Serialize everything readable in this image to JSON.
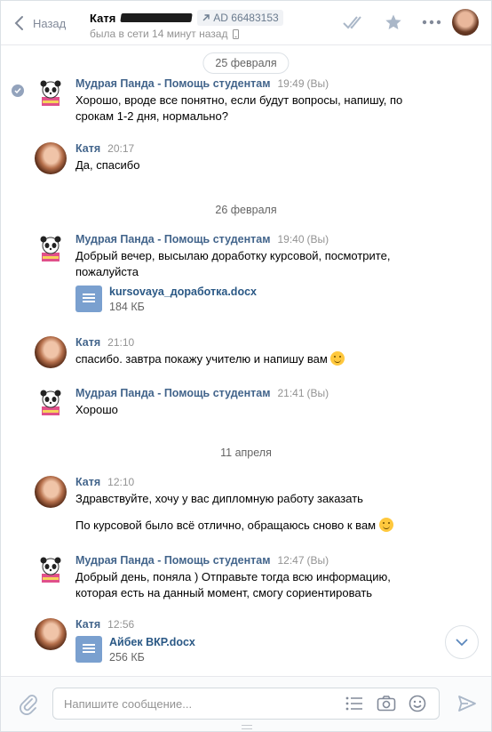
{
  "header": {
    "back_label": "Назад",
    "contact_name": "Катя",
    "ad_badge": "AD 66483153",
    "status": "была в сети 14 минут назад"
  },
  "dates": {
    "d1": "25 февраля",
    "d2": "26 февраля",
    "d3": "11 апреля"
  },
  "messages": [
    {
      "author": "Мудрая Панда - Помощь студентам",
      "time": "19:49",
      "you": "(Вы)",
      "lines": [
        "Хорошо, вроде все понятно, если будут вопросы, напишу, по",
        "срокам 1-2 дня, нормально?"
      ]
    },
    {
      "author": "Катя",
      "time": "20:17",
      "lines": [
        "Да, спасибо"
      ]
    },
    {
      "author": "Мудрая Панда - Помощь студентам",
      "time": "19:40",
      "you": "(Вы)",
      "lines": [
        "Добрый вечер, высылаю доработку курсовой, посмотрите,",
        "пожалуйста"
      ],
      "file": {
        "name": "kursovaya_доработка.docx",
        "size": "184 КБ"
      }
    },
    {
      "author": "Катя",
      "time": "21:10",
      "lines": [
        "спасибо. завтра покажу учителю и напишу вам"
      ]
    },
    {
      "author": "Мудрая Панда - Помощь студентам",
      "time": "21:41",
      "you": "(Вы)",
      "lines": [
        "Хорошо"
      ]
    },
    {
      "author": "Катя",
      "time": "12:10",
      "lines": [
        "Здравствуйте, хочу у вас дипломную работу заказать",
        "По курсовой было всё отлично, обращаюсь сново к вам"
      ]
    },
    {
      "author": "Мудрая Панда - Помощь студентам",
      "time": "12:47",
      "you": "(Вы)",
      "lines": [
        "Добрый день, поняла ) Отправьте тогда всю информацию,",
        "которая есть на данный момент, смогу сориентировать"
      ]
    },
    {
      "author": "Катя",
      "time": "12:56",
      "file": {
        "name": "Айбек ВКР.docx",
        "size": "256 КБ"
      }
    }
  ],
  "composer": {
    "placeholder": "Напишите сообщение..."
  },
  "icons": [
    "back-icon",
    "forward-arrow-icon",
    "phone-icon",
    "double-check-icon",
    "star-icon",
    "more-icon",
    "read-check-icon",
    "document-icon",
    "emoji-smile",
    "chevron-down-icon",
    "paperclip-icon",
    "list-icon",
    "camera-icon",
    "smile-icon",
    "send-icon"
  ],
  "colors": {
    "link": "#42648b",
    "file": "#7aa0cf",
    "muted": "#939393"
  }
}
